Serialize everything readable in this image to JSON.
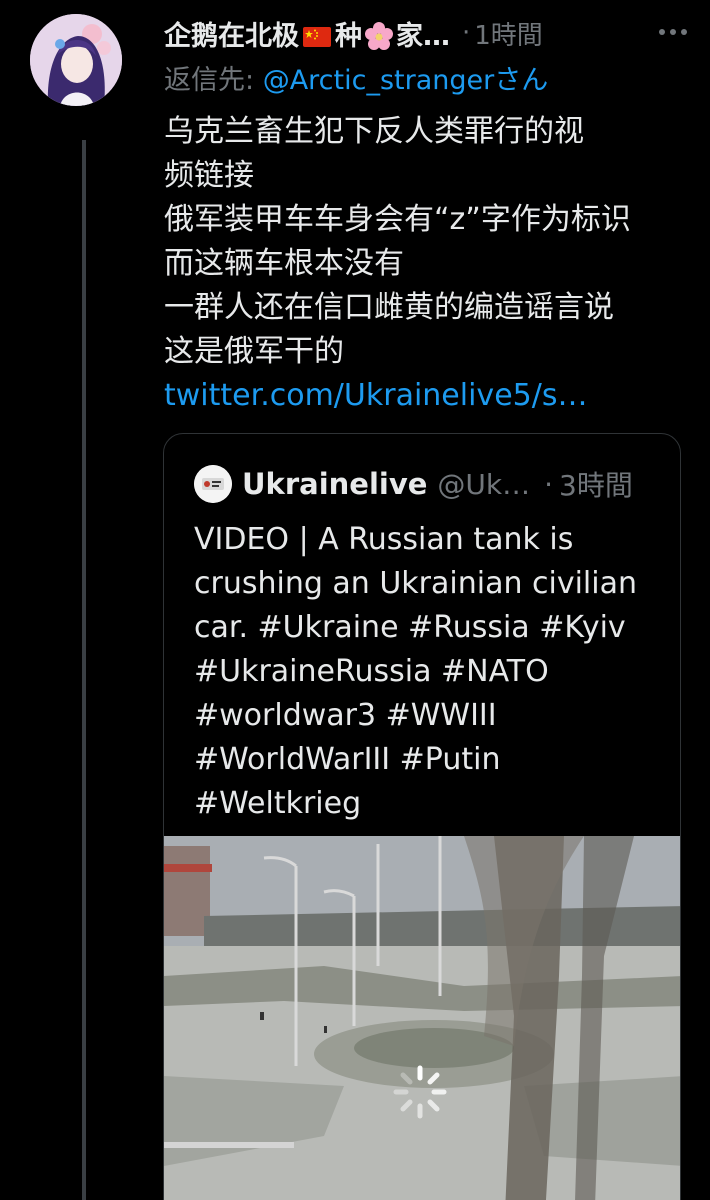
{
  "tweet": {
    "display_name_part1": "企鹅在北极",
    "display_name_part2": "种",
    "display_name_part3": "家…",
    "flag_icon": "china-flag-icon",
    "flower_icon": "cherry-blossom-icon",
    "separator": "·",
    "timestamp": "1時間",
    "reply_prefix": "返信先: ",
    "reply_mention": "@Arctic_stranger",
    "reply_suffix": "さん",
    "lines": [
      "乌克兰畜生犯下反人类罪行的视",
      "频链接",
      "俄军装甲车车身会有“z”字作为标识",
      "而这辆车根本没有",
      "一群人还在信口雌黄的编造谣言说",
      "这是俄军干的"
    ],
    "link": "twitter.com/Ukrainelive5/s…"
  },
  "quote": {
    "name": "Ukrainelive",
    "handle": "@Uk…",
    "separator": "·",
    "timestamp": "3時間",
    "lines": [
      "VIDEO | A Russian tank is",
      "crushing an Ukrainian civilian",
      "car. #Ukraine #Russia #Kyiv",
      "#UkraineRussia #NATO",
      "#worldwar3 #WWIII",
      "#WorldWarIII #Putin",
      "#Weltkrieg"
    ]
  },
  "colors": {
    "background": "#000000",
    "text": "#e7e9ea",
    "secondary": "#71767b",
    "accent": "#1d9bf0",
    "border": "#2f3336"
  }
}
